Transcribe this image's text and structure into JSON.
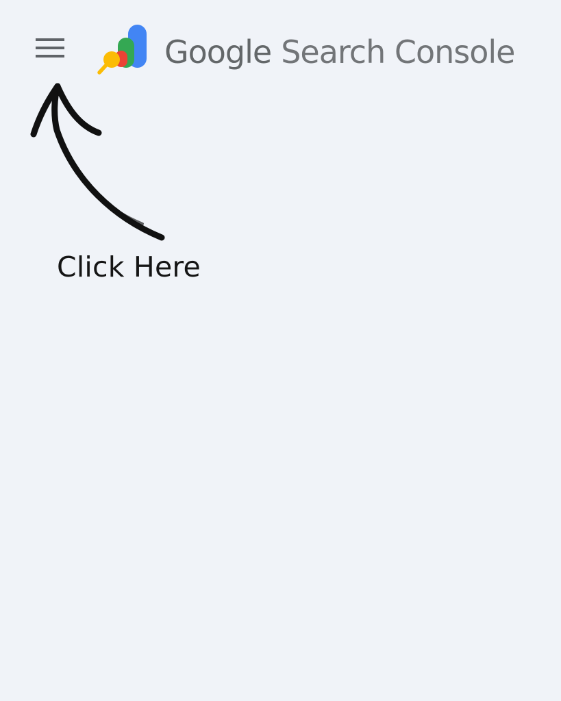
{
  "header": {
    "menu_icon": "hamburger-menu-icon",
    "logo_icon": "search-console-logo-icon",
    "brand_google": "Google",
    "brand_product": "Search Console"
  },
  "annotation": {
    "text": "Click Here",
    "arrow_icon": "hand-drawn-arrow-icon"
  },
  "colors": {
    "background": "#f0f3f8",
    "menu_icon": "#5f6368",
    "brand_text": "#666a6f",
    "logo_blue": "#4285f4",
    "logo_green": "#34a853",
    "logo_red": "#ea4335",
    "logo_yellow": "#fbbc05",
    "annotation": "#111111"
  }
}
